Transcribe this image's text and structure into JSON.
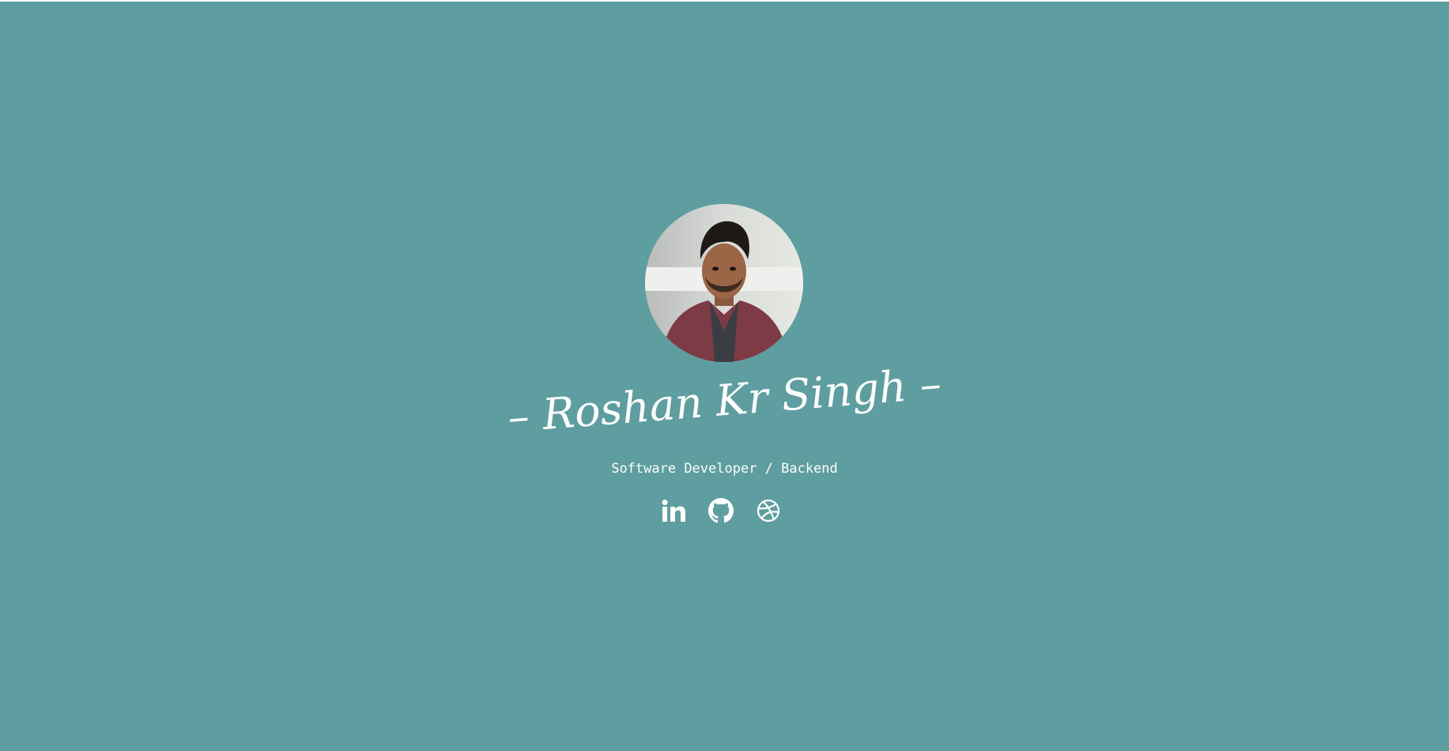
{
  "profile": {
    "name": "Roshan Kr Singh",
    "name_display": "– Roshan Kr Singh –",
    "title": "Software Developer / Backend",
    "photo_icon": "profile-photo"
  },
  "socials": [
    {
      "icon": "linkedin-icon"
    },
    {
      "icon": "github-icon"
    },
    {
      "icon": "dribbble-icon"
    }
  ],
  "colors": {
    "background": "#5e9da0",
    "text": "#ffffff"
  }
}
